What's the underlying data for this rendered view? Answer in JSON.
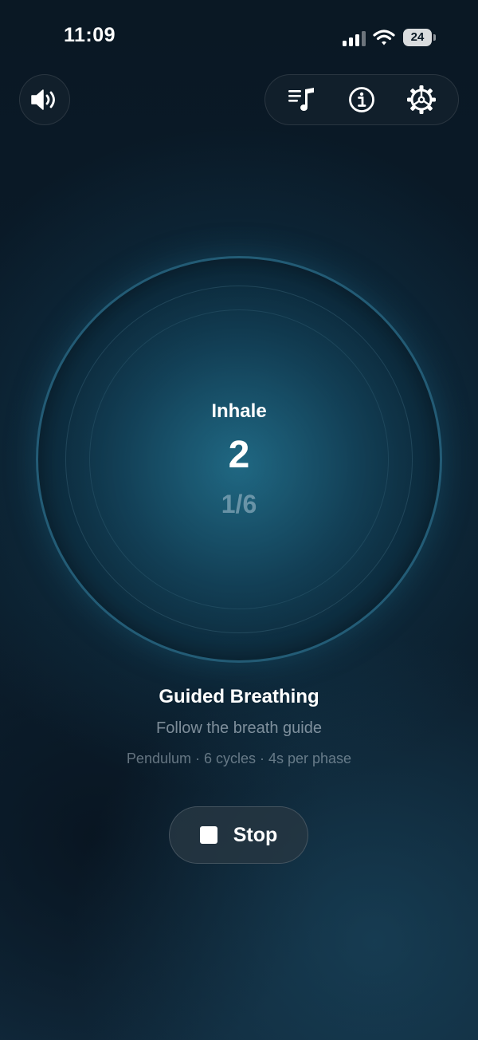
{
  "status_bar": {
    "time": "11:09",
    "battery_level": "24",
    "icons": [
      "signal-icon",
      "wifi-icon",
      "battery-icon"
    ]
  },
  "header": {
    "sound_icon": "speaker-icon",
    "toolbar_icons": [
      "playlist-icon",
      "info-icon",
      "settings-icon"
    ]
  },
  "breath": {
    "phase": "Inhale",
    "count": "2",
    "cycle_progress": "1/6"
  },
  "session": {
    "title": "Guided Breathing",
    "subtitle": "Follow the breath guide",
    "details": "Pendulum · 6 cycles · 4s per phase"
  },
  "controls": {
    "stop_label": "Stop"
  },
  "colors": {
    "background": "#0a1824",
    "accent": "#2e7f9c",
    "text_primary": "#ffffff"
  }
}
